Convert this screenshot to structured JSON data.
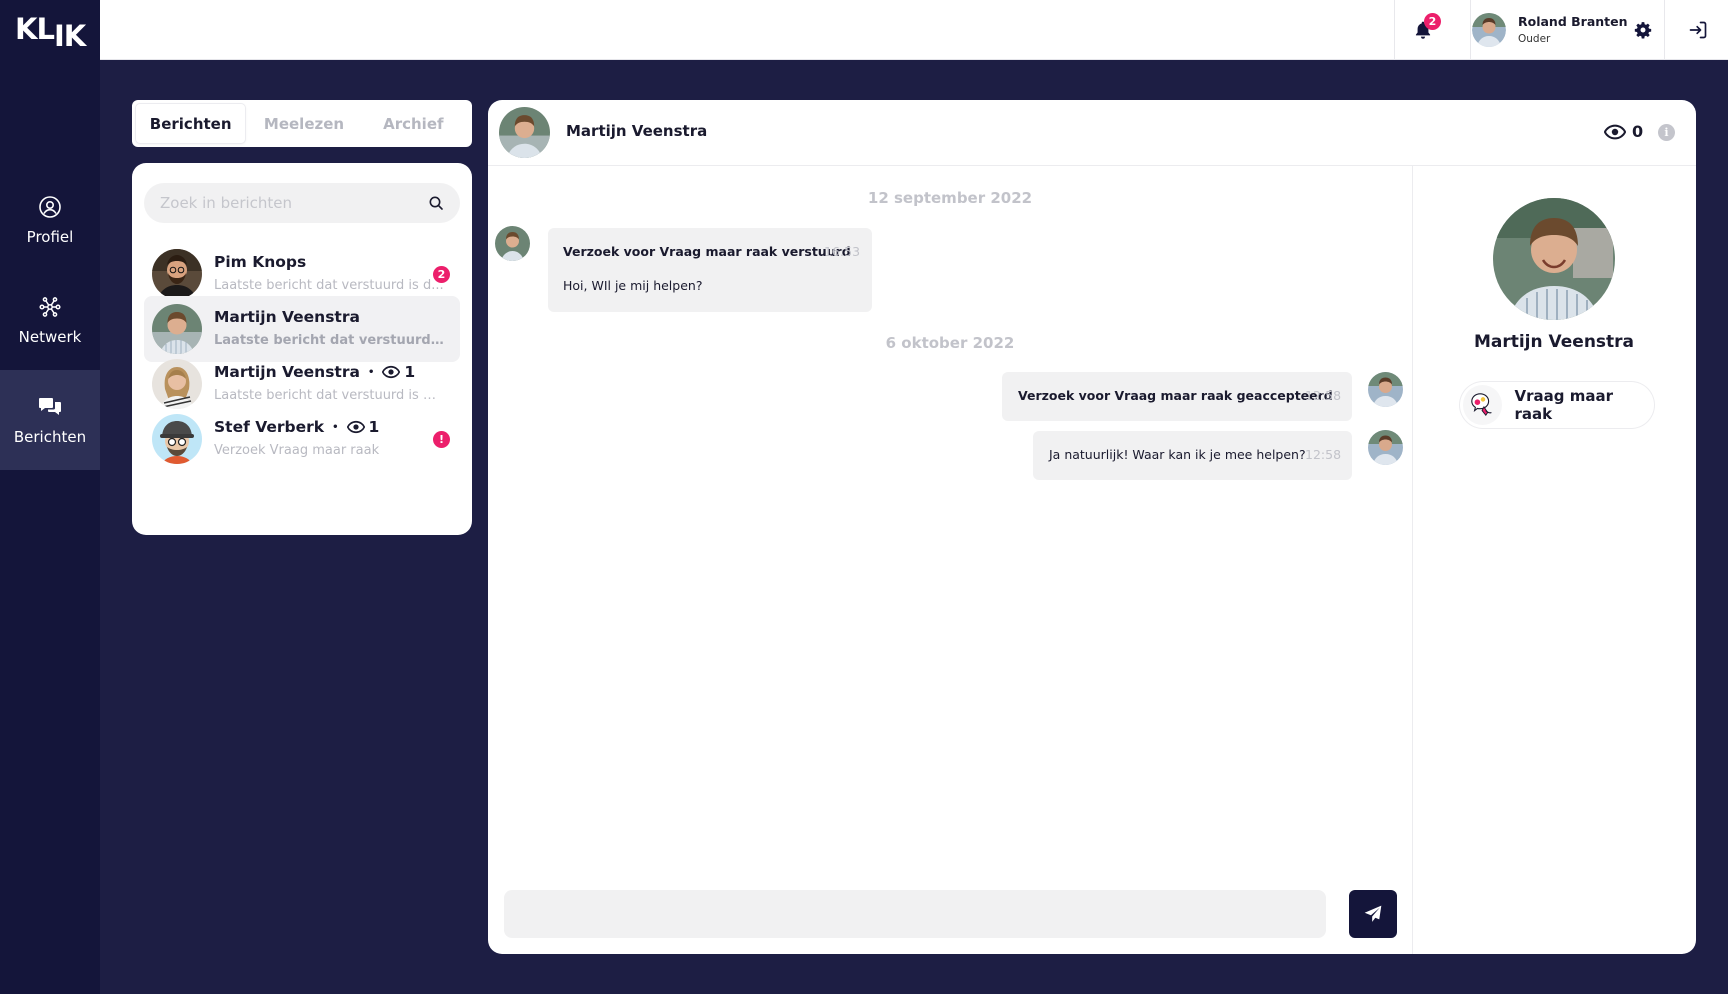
{
  "app": {
    "logo": {
      "part1": "KL",
      "part2": "IK"
    },
    "nav": [
      {
        "label": "Profiel",
        "icon": "profile-icon"
      },
      {
        "label": "Netwerk",
        "icon": "network-icon"
      },
      {
        "label": "Berichten",
        "icon": "chat-icon",
        "active": true
      }
    ]
  },
  "topbar": {
    "notification_count": "2",
    "user": {
      "name": "Roland Branten",
      "role": "Ouder"
    }
  },
  "tabs": [
    {
      "label": "Berichten",
      "active": true
    },
    {
      "label": "Meelezen"
    },
    {
      "label": "Archief"
    }
  ],
  "search": {
    "placeholder": "Zoek in berichten"
  },
  "conversations": [
    {
      "name": "Pim Knops",
      "preview": "Laatste bericht dat verstuurd is d...",
      "badge": "2",
      "badge_type": "count"
    },
    {
      "name": "Martijn Veenstra",
      "preview": "Laatste bericht dat verstuurd is doo...",
      "selected": true
    },
    {
      "name": "Martijn Veenstra",
      "views": "1",
      "preview": "Laatste bericht dat verstuurd is door..."
    },
    {
      "name": "Stef Verberk",
      "views": "1",
      "preview": "Verzoek Vraag maar raak",
      "badge": "!",
      "badge_type": "alert"
    }
  ],
  "chat": {
    "contact_name": "Martijn Veenstra",
    "views": "0",
    "groups": [
      {
        "date": "12 september 2022",
        "messages": [
          {
            "direction": "incoming",
            "title": "Verzoek voor Vraag maar raak verstuurd",
            "time": "16:53",
            "text": "Hoi, WIl je mij helpen?"
          }
        ]
      },
      {
        "date": "6 oktober 2022",
        "messages": [
          {
            "direction": "outgoing",
            "title": "Verzoek voor Vraag maar raak geaccepteerd",
            "time": "12:58"
          },
          {
            "direction": "outgoing",
            "text": "Ja natuurlijk! Waar kan ik je mee helpen?",
            "time": "12:58"
          }
        ]
      }
    ],
    "composer_value": ""
  },
  "profile": {
    "name": "Martijn Veenstra",
    "request_chip": "Vraag maar raak"
  },
  "colors": {
    "background": "#1d1e44",
    "sidebar": "#14153a",
    "accent": "#ec1f6b"
  }
}
